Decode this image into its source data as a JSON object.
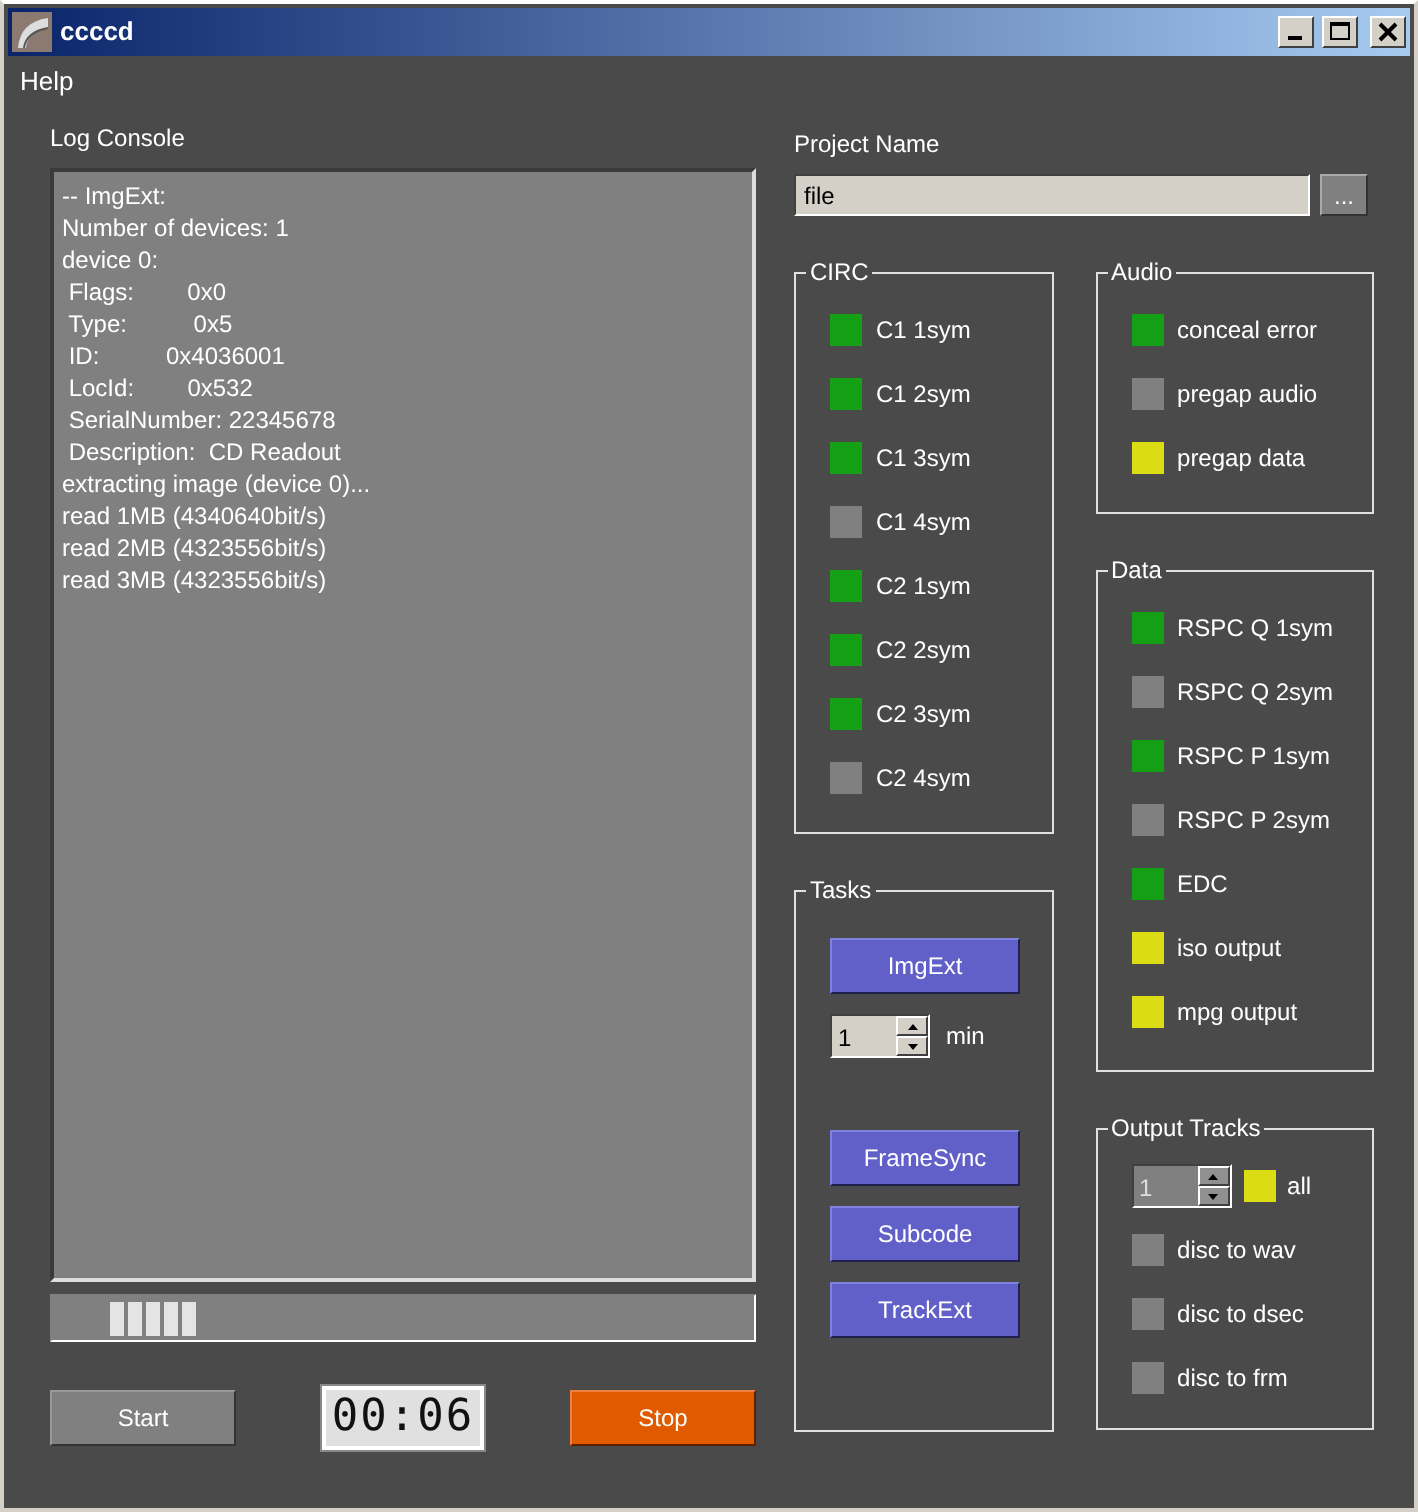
{
  "window": {
    "title": "ccccd"
  },
  "menu": [
    "Help"
  ],
  "log_console": {
    "title": "Log Console",
    "lines": [
      "-- ImgExt:",
      "Number of devices: 1",
      "device 0:",
      " Flags:        0x0",
      " Type:          0x5",
      " ID:          0x4036001",
      " LocId:        0x532",
      " SerialNumber: 22345678",
      " Description:  CD Readout",
      "extracting image (device 0)...",
      "read 1MB (4340640bit/s)",
      "read 2MB (4323556bit/s)",
      "read 3MB (4323556bit/s)"
    ]
  },
  "project": {
    "label": "Project Name",
    "value": "file",
    "browse_button": "..."
  },
  "circ": {
    "title": "CIRC",
    "items": [
      {
        "label": "C1 1sym",
        "color": "#14a014"
      },
      {
        "label": "C1 2sym",
        "color": "#14a014"
      },
      {
        "label": "C1 3sym",
        "color": "#14a014"
      },
      {
        "label": "C1 4sym",
        "color": "#808080"
      },
      {
        "label": "C2 1sym",
        "color": "#14a014"
      },
      {
        "label": "C2 2sym",
        "color": "#14a014"
      },
      {
        "label": "C2 3sym",
        "color": "#14a014"
      },
      {
        "label": "C2 4sym",
        "color": "#808080"
      }
    ]
  },
  "audio": {
    "title": "Audio",
    "items": [
      {
        "label": "conceal error",
        "color": "#14a014"
      },
      {
        "label": "pregap audio",
        "color": "#808080"
      },
      {
        "label": "pregap data",
        "color": "#dcdc14"
      }
    ]
  },
  "data": {
    "title": "Data",
    "items": [
      {
        "label": "RSPC Q 1sym",
        "color": "#14a014"
      },
      {
        "label": "RSPC Q 2sym",
        "color": "#808080"
      },
      {
        "label": "RSPC P 1sym",
        "color": "#14a014"
      },
      {
        "label": "RSPC P 2sym",
        "color": "#808080"
      },
      {
        "label": "EDC",
        "color": "#14a014"
      },
      {
        "label": "iso output",
        "color": "#dcdc14"
      },
      {
        "label": "mpg output",
        "color": "#dcdc14"
      }
    ]
  },
  "tasks": {
    "title": "Tasks",
    "items": [
      {
        "kind": "button",
        "label": "ImgExt"
      },
      {
        "kind": "spin",
        "value": "1",
        "unit": "min"
      },
      {
        "kind": "button",
        "label": "FrameSync"
      },
      {
        "kind": "button",
        "label": "Subcode"
      },
      {
        "kind": "button",
        "label": "TrackExt"
      }
    ]
  },
  "output_tracks": {
    "title": "Output Tracks",
    "spin_value": "1",
    "all": {
      "label": "all",
      "color": "#dcdc14"
    },
    "items": [
      {
        "label": "disc to wav",
        "color": "#808080"
      },
      {
        "label": "disc to dsec",
        "color": "#808080"
      },
      {
        "label": "disc to frm",
        "color": "#808080"
      }
    ]
  },
  "start_button": "Start",
  "timer": "00:06",
  "stop_button": "Stop"
}
